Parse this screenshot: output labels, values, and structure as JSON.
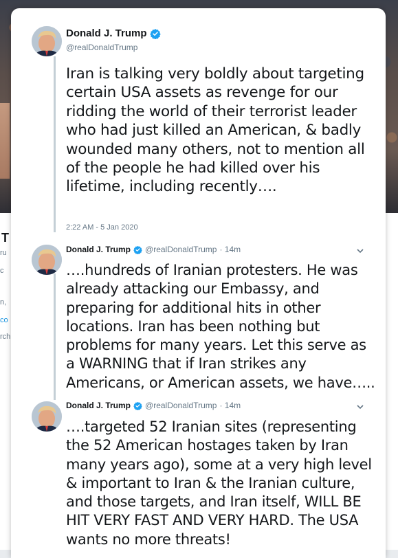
{
  "author": {
    "name": "Donald J. Trump",
    "handle": "@realDonaldTrump"
  },
  "main_tweet": {
    "text": "Iran is talking very boldly about targeting certain USA assets as revenge for our ridding the world of their terrorist leader who had just killed an American, & badly wounded many others, not to mention all of the people he had killed over his lifetime, including recently….",
    "timestamp": "2:22 AM - 5 Jan 2020"
  },
  "replies": [
    {
      "name": "Donald J. Trump",
      "handle": "@realDonaldTrump",
      "time": "· 14m",
      "text": "….hundreds of Iranian protesters. He was already attacking our Embassy, and preparing for additional hits in other locations. Iran has been nothing but problems for many years. Let this serve as a WARNING that if Iran strikes any Americans, or American assets, we have….."
    },
    {
      "name": "Donald J. Trump",
      "handle": "@realDonaldTrump",
      "time": "· 14m",
      "text": "….targeted 52 Iranian sites (representing the 52 American hostages taken by Iran many years ago), some at a very high level & important to Iran &  the Iranian culture, and those targets, and Iran itself, WILL BE HIT VERY FAST AND VERY HARD. The USA wants no more threats!"
    }
  ],
  "background": {
    "title_fragment": "T",
    "snippets": [
      "ru",
      "c",
      "n,",
      "co",
      "rch"
    ]
  },
  "colors": {
    "verified": "#1da1f2",
    "secondary_text": "#657786",
    "thread_line": "#c4cfd6"
  },
  "icons": {
    "verified": "verified-badge-icon",
    "caret": "chevron-down-icon"
  }
}
